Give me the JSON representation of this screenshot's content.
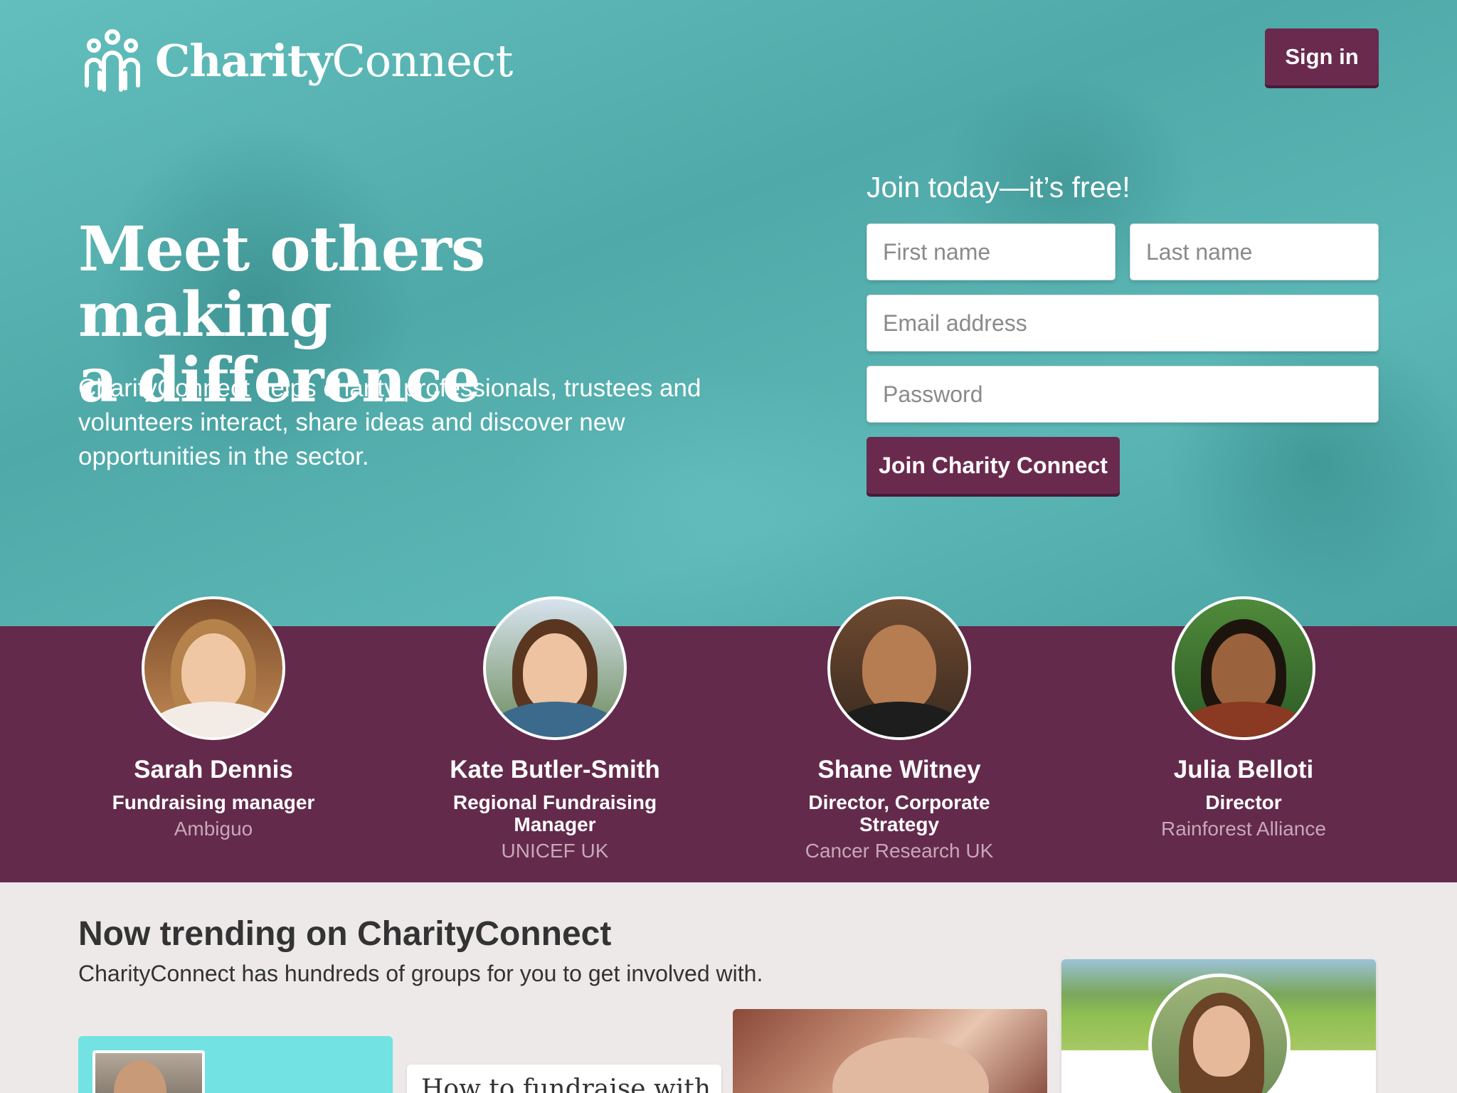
{
  "header": {
    "brand_bold": "Charity",
    "brand_light": "Connect",
    "signin_label": "Sign in"
  },
  "hero": {
    "headline_line1": "Meet others making",
    "headline_line2": "a difference",
    "lede": "CharityConnect helps charity professionals, trustees and volunteers interact, share ideas and discover new opportunities in the sector."
  },
  "signup": {
    "title": "Join today—it’s free!",
    "first_name_placeholder": "First name",
    "last_name_placeholder": "Last name",
    "email_placeholder": "Email address",
    "password_placeholder": "Password",
    "submit_label": "Join Charity Connect"
  },
  "people": [
    {
      "name": "Sarah Dennis",
      "role": "Fundraising manager",
      "org": "Ambiguo"
    },
    {
      "name": "Kate Butler-Smith",
      "role": "Regional Fundraising Manager",
      "org": "UNICEF UK"
    },
    {
      "name": "Shane Witney",
      "role": "Director, Corporate Strategy",
      "org": "Cancer Research UK"
    },
    {
      "name": "Julia Belloti",
      "role": "Director",
      "org": "Rainforest Alliance"
    }
  ],
  "trending": {
    "title": "Now trending on CharityConnect",
    "subtitle": "CharityConnect has hundreds of groups for you to get involved with.",
    "card2_title": "How to fundraise with"
  },
  "colors": {
    "accent_plum": "#6a2a4e",
    "band_plum": "#632a4b",
    "hero_teal": "#58b5b4"
  }
}
